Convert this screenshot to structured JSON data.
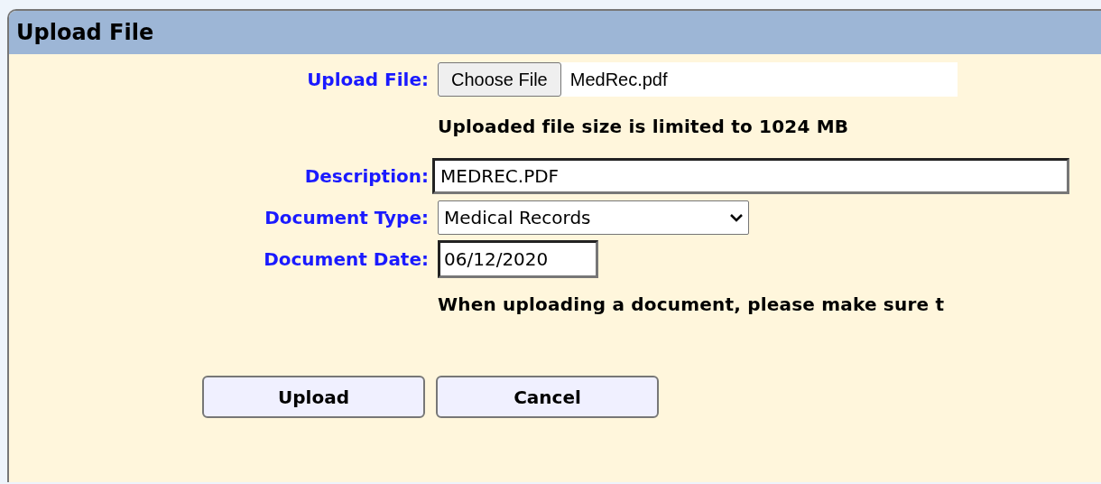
{
  "panel": {
    "title": "Upload File"
  },
  "rows": [
    {
      "kind": "file",
      "label": "Upload File:",
      "button": "Choose File",
      "value": "MedRec.pdf"
    },
    {
      "kind": "note",
      "text": "Uploaded file size is limited to 1024 MB"
    },
    {
      "kind": "text",
      "label": "Description:",
      "value": "MEDREC.PDF"
    },
    {
      "kind": "select",
      "label": "Document Type:",
      "value": "Medical Records"
    },
    {
      "kind": "date",
      "label": "Document Date:",
      "value": "06/12/2020"
    },
    {
      "kind": "note",
      "text": "When uploading a document, please make sure t"
    }
  ],
  "buttons": [
    "Upload",
    "Cancel"
  ]
}
